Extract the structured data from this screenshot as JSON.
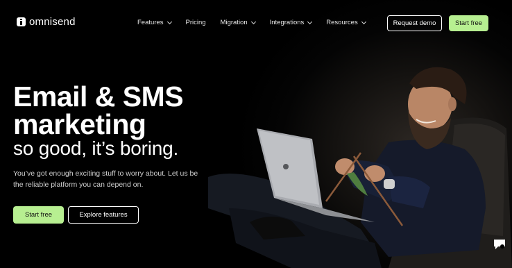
{
  "nav": {
    "logo_text": "omnisend",
    "menu": [
      {
        "label": "Features",
        "has_dropdown": true
      },
      {
        "label": "Pricing",
        "has_dropdown": false
      },
      {
        "label": "Migration",
        "has_dropdown": true
      },
      {
        "label": "Integrations",
        "has_dropdown": true
      },
      {
        "label": "Resources",
        "has_dropdown": true
      }
    ],
    "request_demo_label": "Request demo",
    "start_free_label": "Start free"
  },
  "hero": {
    "headline_line1": "Email & SMS",
    "headline_line2": "marketing",
    "headline_line3": "so good, it’s boring.",
    "subtext": "You’ve got enough exciting stuff to worry about. Let us be the reliable platform you can depend on.",
    "primary_cta": "Start free",
    "secondary_cta": "Explore features"
  },
  "colors": {
    "background": "#000000",
    "accent_green": "#b7ef91",
    "text": "#ffffff"
  },
  "icons": {
    "logo": "omnisend-logo-icon",
    "chat": "chat-bubble-icon",
    "dropdown": "chevron-down-icon"
  }
}
